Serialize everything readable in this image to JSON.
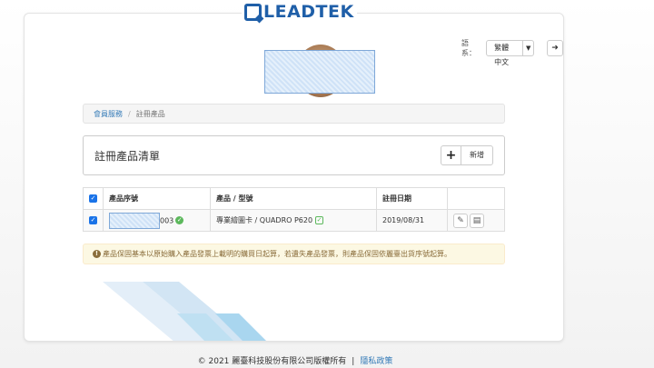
{
  "header": {
    "logo_text": "LEADTEK",
    "lang_label": "語系：",
    "lang_value": "繁體中文",
    "logout_icon": "logout-icon"
  },
  "breadcrumb": {
    "home": "會員服務",
    "separator": "/",
    "current": "註冊產品"
  },
  "panel": {
    "title": "註冊產品清單",
    "add_label": "新增"
  },
  "table": {
    "headers": [
      "產品序號",
      "產品 / 型號",
      "註冊日期"
    ],
    "rows": [
      {
        "serial_suffix": "003",
        "product": "專業繪圖卡 / QUADRO P620",
        "date": "2019/08/31"
      }
    ]
  },
  "alert": {
    "text": "產品保固基本以原始購入產品發票上載明的購買日起算，若遺失產品發票，則產品保固依麗臺出貨序號起算。"
  },
  "footer": {
    "copyright": "© 2021 麗臺科技股份有限公司版權所有",
    "separator": "|",
    "privacy": "隱私政策"
  },
  "colors": {
    "brand": "#1f5fa8",
    "link": "#337ab7",
    "alert_bg": "#fcf8e3",
    "alert_text": "#8a6d3b",
    "check": "#1a73e8",
    "success": "#5cb85c"
  }
}
